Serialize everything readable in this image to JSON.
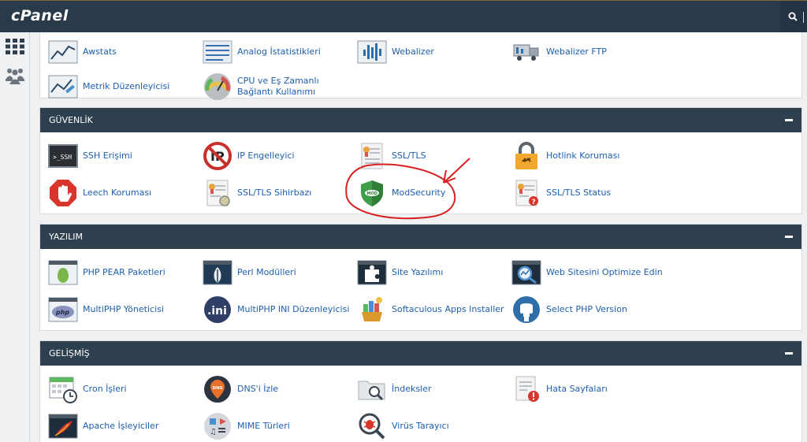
{
  "app": {
    "logo": "cPanel"
  },
  "sidebar": {
    "items": [
      "grid-icon",
      "users-icon"
    ]
  },
  "top_section": {
    "items": [
      {
        "label": "Awstats",
        "icon": "awstats-icon"
      },
      {
        "label": "Analog İstatistikleri",
        "icon": "analog-stats-icon"
      },
      {
        "label": "Webalizer",
        "icon": "webalizer-icon"
      },
      {
        "label": "Webalizer FTP",
        "icon": "webalizer-ftp-icon"
      },
      {
        "label": "Metrik Düzenleyicisi",
        "icon": "metrics-editor-icon"
      },
      {
        "label": "CPU ve Eş Zamanlı Bağlantı Kullanımı",
        "icon": "gauge-icon"
      }
    ]
  },
  "security": {
    "title": "GÜVENLİK",
    "items": [
      {
        "label": "SSH Erişimi",
        "icon": "ssh-icon"
      },
      {
        "label": "IP Engelleyici",
        "icon": "ip-blocker-icon"
      },
      {
        "label": "SSL/TLS",
        "icon": "ssl-certificate-icon"
      },
      {
        "label": "Hotlink Koruması",
        "icon": "padlock-icon"
      },
      {
        "label": "Leech Koruması",
        "icon": "hand-stop-icon"
      },
      {
        "label": "SSL/TLS Sihirbazı",
        "icon": "ssl-wizard-icon"
      },
      {
        "label": "ModSecurity",
        "icon": "shield-icon"
      },
      {
        "label": "SSL/TLS Status",
        "icon": "ssl-status-icon"
      }
    ]
  },
  "software": {
    "title": "YAZILIM",
    "items": [
      {
        "label": "PHP PEAR Paketleri",
        "icon": "pear-icon"
      },
      {
        "label": "Perl Modülleri",
        "icon": "perl-onion-icon"
      },
      {
        "label": "Site Yazılımı",
        "icon": "puzzle-icon"
      },
      {
        "label": "Web Sitesini Optimize Edin",
        "icon": "magnifier-chart-icon"
      },
      {
        "label": "MultiPHP Yöneticisi",
        "icon": "php-icon"
      },
      {
        "label": "MultiPHP INI Düzenleyicisi",
        "icon": "ini-icon"
      },
      {
        "label": "Softaculous Apps Installer",
        "icon": "softaculous-icon"
      },
      {
        "label": "Select PHP Version",
        "icon": "php-elephant-icon"
      }
    ]
  },
  "advanced": {
    "title": "GELİŞMİŞ",
    "items": [
      {
        "label": "Cron İşleri",
        "icon": "calendar-clock-icon"
      },
      {
        "label": "DNS'i İzle",
        "icon": "dns-pin-icon"
      },
      {
        "label": "İndeksler",
        "icon": "folder-search-icon"
      },
      {
        "label": "Hata Sayfaları",
        "icon": "error-page-icon"
      },
      {
        "label": "Apache İşleyiciler",
        "icon": "apache-feather-icon"
      },
      {
        "label": "MIME Türleri",
        "icon": "mime-icon"
      },
      {
        "label": "Virüs Tarayıcı",
        "icon": "bug-scan-icon"
      }
    ]
  },
  "colors": {
    "header": "#2e3f50",
    "topbar": "#293a4a",
    "link": "#1d5fae",
    "annotation": "#d92020"
  }
}
